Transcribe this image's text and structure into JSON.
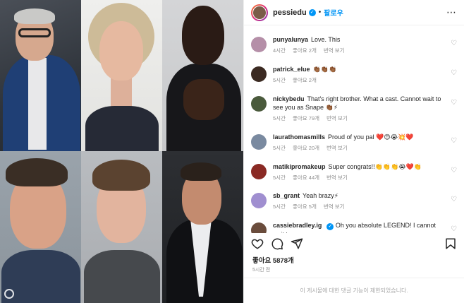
{
  "post": {
    "username": "pessiedu",
    "verified_mark": "✓",
    "separator": "•",
    "follow_label": "팔로우",
    "more_icon": "⋯",
    "likes_text": "좋아요 5878개",
    "time_text": "5시간 전",
    "comments_disabled_text": "이 게시물에 대한 댓글 기능이 제한되었습니다."
  },
  "comments": [
    {
      "user": "punyalunya",
      "text": "Love. This",
      "time": "4시간",
      "likes": "좋아요 2개",
      "reply": "번역 보기",
      "avatar_color": "#b58fa8"
    },
    {
      "user": "patrick_elue",
      "text": "👏🏾👏🏾👏🏾",
      "time": "5시간",
      "likes": "좋아요 2개",
      "reply": "",
      "avatar_color": "#3b2a22"
    },
    {
      "user": "nickybedu",
      "text": "That's right brother. What a cast. Cannot wait to see you as Snape 👏🏾⚡",
      "time": "5시간",
      "likes": "좋아요 79개",
      "reply": "번역 보기",
      "avatar_color": "#4a5a3c"
    },
    {
      "user": "laurathomasmills",
      "text": "Proud of you pal ❤️😍😭💥❤️",
      "time": "5시간",
      "likes": "좋아요 20개",
      "reply": "번역 보기",
      "avatar_color": "#7a8aa0"
    },
    {
      "user": "matikipromakeup",
      "text": "Super congrats!!👏👏👏😭❤️👏",
      "time": "5시간",
      "likes": "좋아요 44개",
      "reply": "번역 보기",
      "avatar_color": "#8a2a24"
    },
    {
      "user": "sb_grant",
      "text": "Yeah brazy⚡",
      "time": "5시간",
      "likes": "좋아요 5개",
      "reply": "번역 보기",
      "avatar_color": "#a08fd0"
    },
    {
      "user": "cassiebradley.ig",
      "text": "Oh you absolute LEGEND! I cannot wait to",
      "time": "",
      "likes": "",
      "reply": "",
      "avatar_color": "#6a4c3c"
    }
  ],
  "icons": {
    "heart": "♡",
    "like": "heart-icon",
    "comment": "comment-icon",
    "share": "share-icon",
    "save": "bookmark-icon"
  }
}
